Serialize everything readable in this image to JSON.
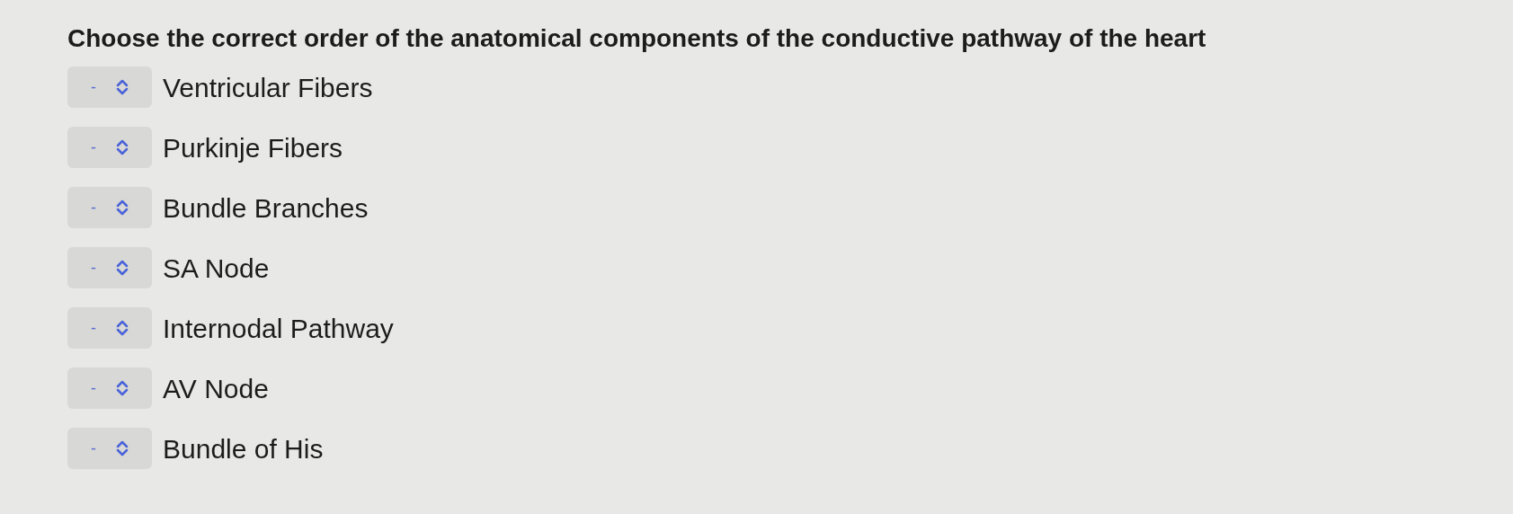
{
  "question": "Choose the correct order of the anatomical components of the conductive pathway of the heart",
  "items": [
    {
      "value": "-",
      "label": "Ventricular Fibers"
    },
    {
      "value": "-",
      "label": "Purkinje Fibers"
    },
    {
      "value": "-",
      "label": "Bundle Branches"
    },
    {
      "value": "-",
      "label": "SA Node"
    },
    {
      "value": "-",
      "label": "Internodal Pathway"
    },
    {
      "value": "-",
      "label": "AV Node"
    },
    {
      "value": "-",
      "label": "Bundle of His"
    }
  ]
}
